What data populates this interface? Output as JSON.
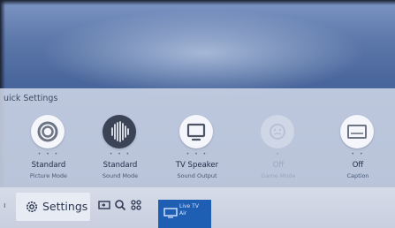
{
  "quick_settings": {
    "title": "uick Settings",
    "items": [
      {
        "value": "Standard",
        "sub": "Picture Mode",
        "icon": "picture-mode-icon",
        "enabled": true
      },
      {
        "value": "Standard",
        "sub": "Sound Mode",
        "icon": "sound-wave-icon",
        "enabled": true
      },
      {
        "value": "TV Speaker",
        "sub": "Sound Output",
        "icon": "tv-monitor-icon",
        "enabled": true
      },
      {
        "value": "Off",
        "sub": "Game Mode",
        "icon": "gamepad-icon",
        "enabled": false
      },
      {
        "value": "Off",
        "sub": "Caption",
        "icon": "caption-icon",
        "enabled": true
      }
    ],
    "dots": "• • •"
  },
  "bottom_bar": {
    "left_stub": "ı",
    "settings_label": "Settings",
    "live_tv_label_line1": "Live TV",
    "live_tv_label_line2": "Air"
  },
  "colors": {
    "accent": "#1e5fb3",
    "panel": "#cdd5e6",
    "text": "#1f2b46"
  }
}
